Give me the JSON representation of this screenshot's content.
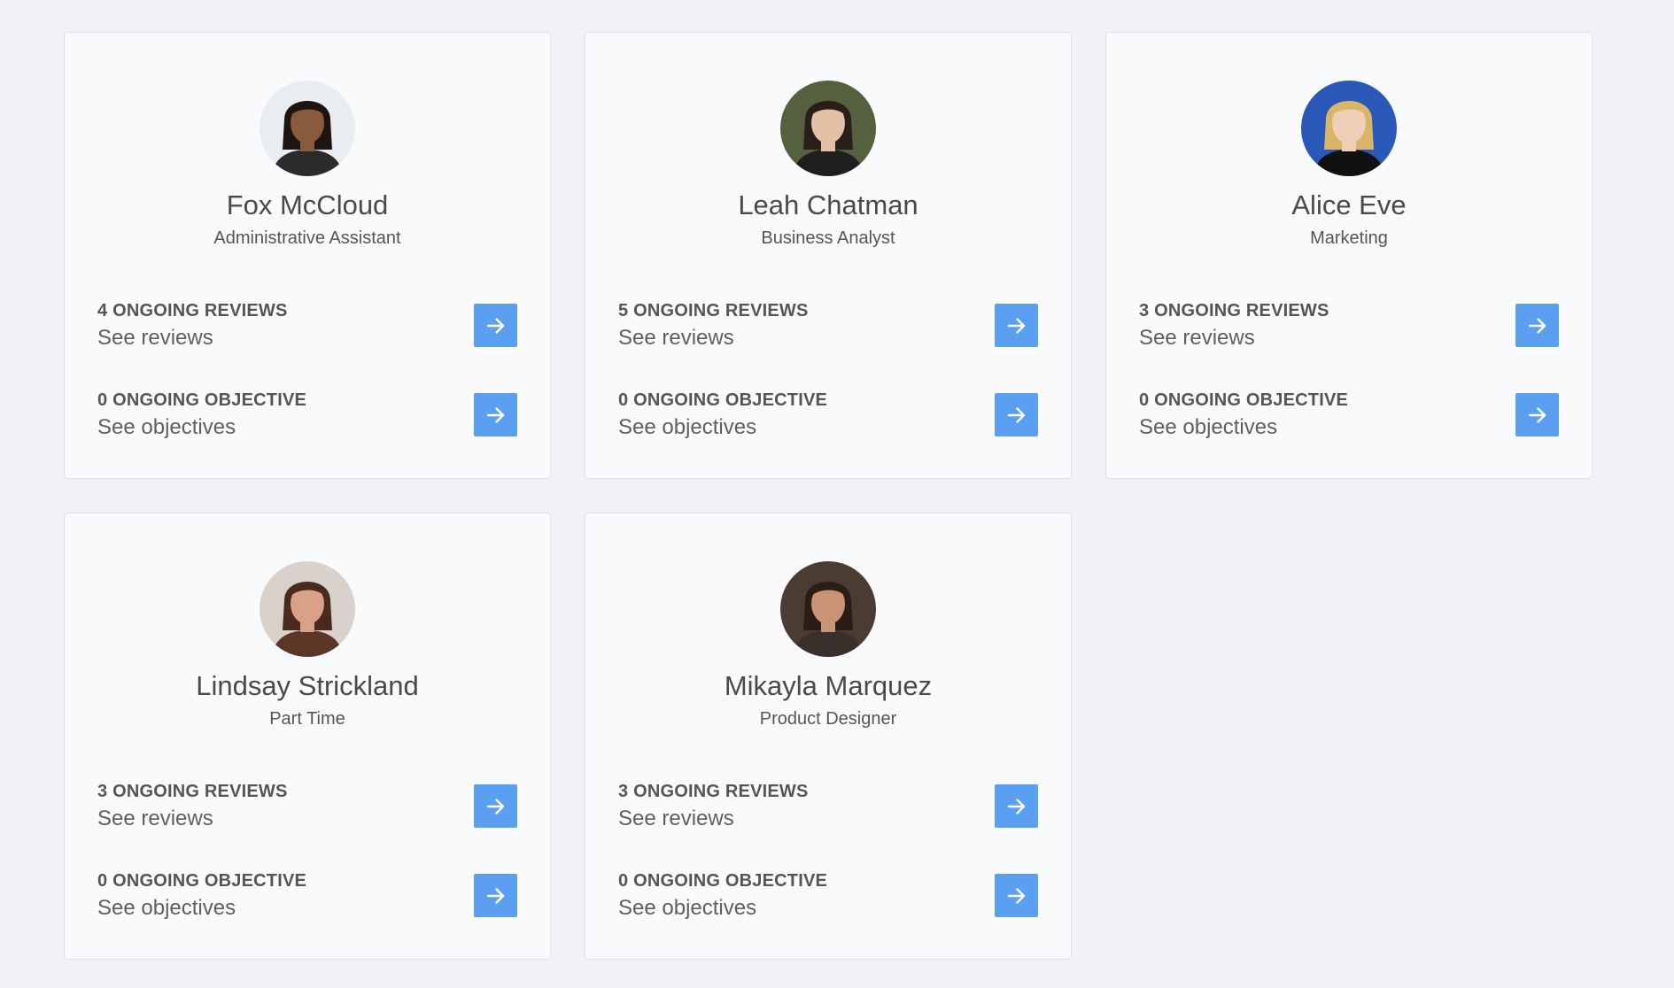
{
  "cards": [
    {
      "name": "Fox McCloud",
      "role": "Administrative Assistant",
      "reviews_count": "4 ONGOING REVIEWS",
      "reviews_link": "See reviews",
      "objectives_count": "0 ONGOING OBJECTIVE",
      "objectives_link": "See objectives",
      "avatar": {
        "bg": "#e9edf2",
        "skin": "#8a5a3c",
        "hair": "#1d1512",
        "shirt": "#2b2b2b"
      }
    },
    {
      "name": "Leah Chatman",
      "role": "Business Analyst",
      "reviews_count": "5 ONGOING REVIEWS",
      "reviews_link": "See reviews",
      "objectives_count": "0 ONGOING OBJECTIVE",
      "objectives_link": "See objectives",
      "avatar": {
        "bg": "#55603f",
        "skin": "#e3c1a6",
        "hair": "#2a1f18",
        "shirt": "#1f1f1f"
      }
    },
    {
      "name": "Alice Eve",
      "role": "Marketing",
      "reviews_count": "3 ONGOING REVIEWS",
      "reviews_link": "See reviews",
      "objectives_count": "0 ONGOING OBJECTIVE",
      "objectives_link": "See objectives",
      "avatar": {
        "bg": "#2a58b8",
        "skin": "#efcfb6",
        "hair": "#d9b56a",
        "shirt": "#111111"
      }
    },
    {
      "name": "Lindsay Strickland",
      "role": "Part Time",
      "reviews_count": "3 ONGOING REVIEWS",
      "reviews_link": "See reviews",
      "objectives_count": "0 ONGOING OBJECTIVE",
      "objectives_link": "See objectives",
      "avatar": {
        "bg": "#d9d2cc",
        "skin": "#d9a287",
        "hair": "#4a2a1c",
        "shirt": "#5b3526"
      }
    },
    {
      "name": "Mikayla Marquez",
      "role": "Product Designer",
      "reviews_count": "3 ONGOING REVIEWS",
      "reviews_link": "See reviews",
      "objectives_count": "0 ONGOING OBJECTIVE",
      "objectives_link": "See objectives",
      "avatar": {
        "bg": "#4a3c33",
        "skin": "#c99376",
        "hair": "#2a1d16",
        "shirt": "#3a2f2a"
      }
    }
  ],
  "colors": {
    "page_bg": "#f1f2f5",
    "card_bg": "#f9fafc",
    "button": "#5a9ff0",
    "text_dark": "#4a4a4a"
  },
  "icons": {
    "go_button": "arrow-right-icon",
    "avatar": "person-photo"
  }
}
